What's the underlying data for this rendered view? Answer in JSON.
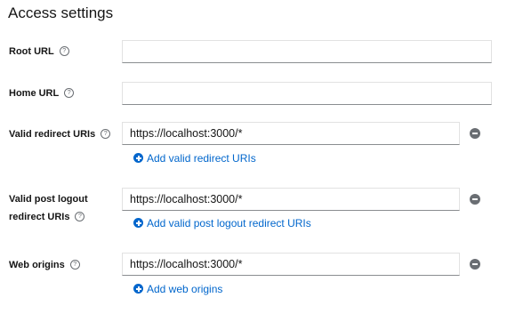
{
  "section": {
    "title": "Access settings"
  },
  "fields": {
    "root_url": {
      "label": "Root URL",
      "value": "",
      "help_icon": "help-circle-icon"
    },
    "home_url": {
      "label": "Home URL",
      "value": "",
      "help_icon": "help-circle-icon"
    },
    "valid_redirect_uris": {
      "label": "Valid redirect URIs",
      "values": [
        "https://localhost:3000/*"
      ],
      "add_label": "Add valid redirect URIs"
    },
    "valid_post_logout": {
      "label_line1": "Valid post logout",
      "label_line2": "redirect URIs",
      "values": [
        "https://localhost:3000/*"
      ],
      "add_label": "Add valid post logout redirect URIs"
    },
    "web_origins": {
      "label": "Web origins",
      "values": [
        "https://localhost:3000/*"
      ],
      "add_label": "Add web origins"
    }
  },
  "colors": {
    "link": "#0066cc",
    "icon_gray": "#6a6e73",
    "text": "#151515"
  }
}
